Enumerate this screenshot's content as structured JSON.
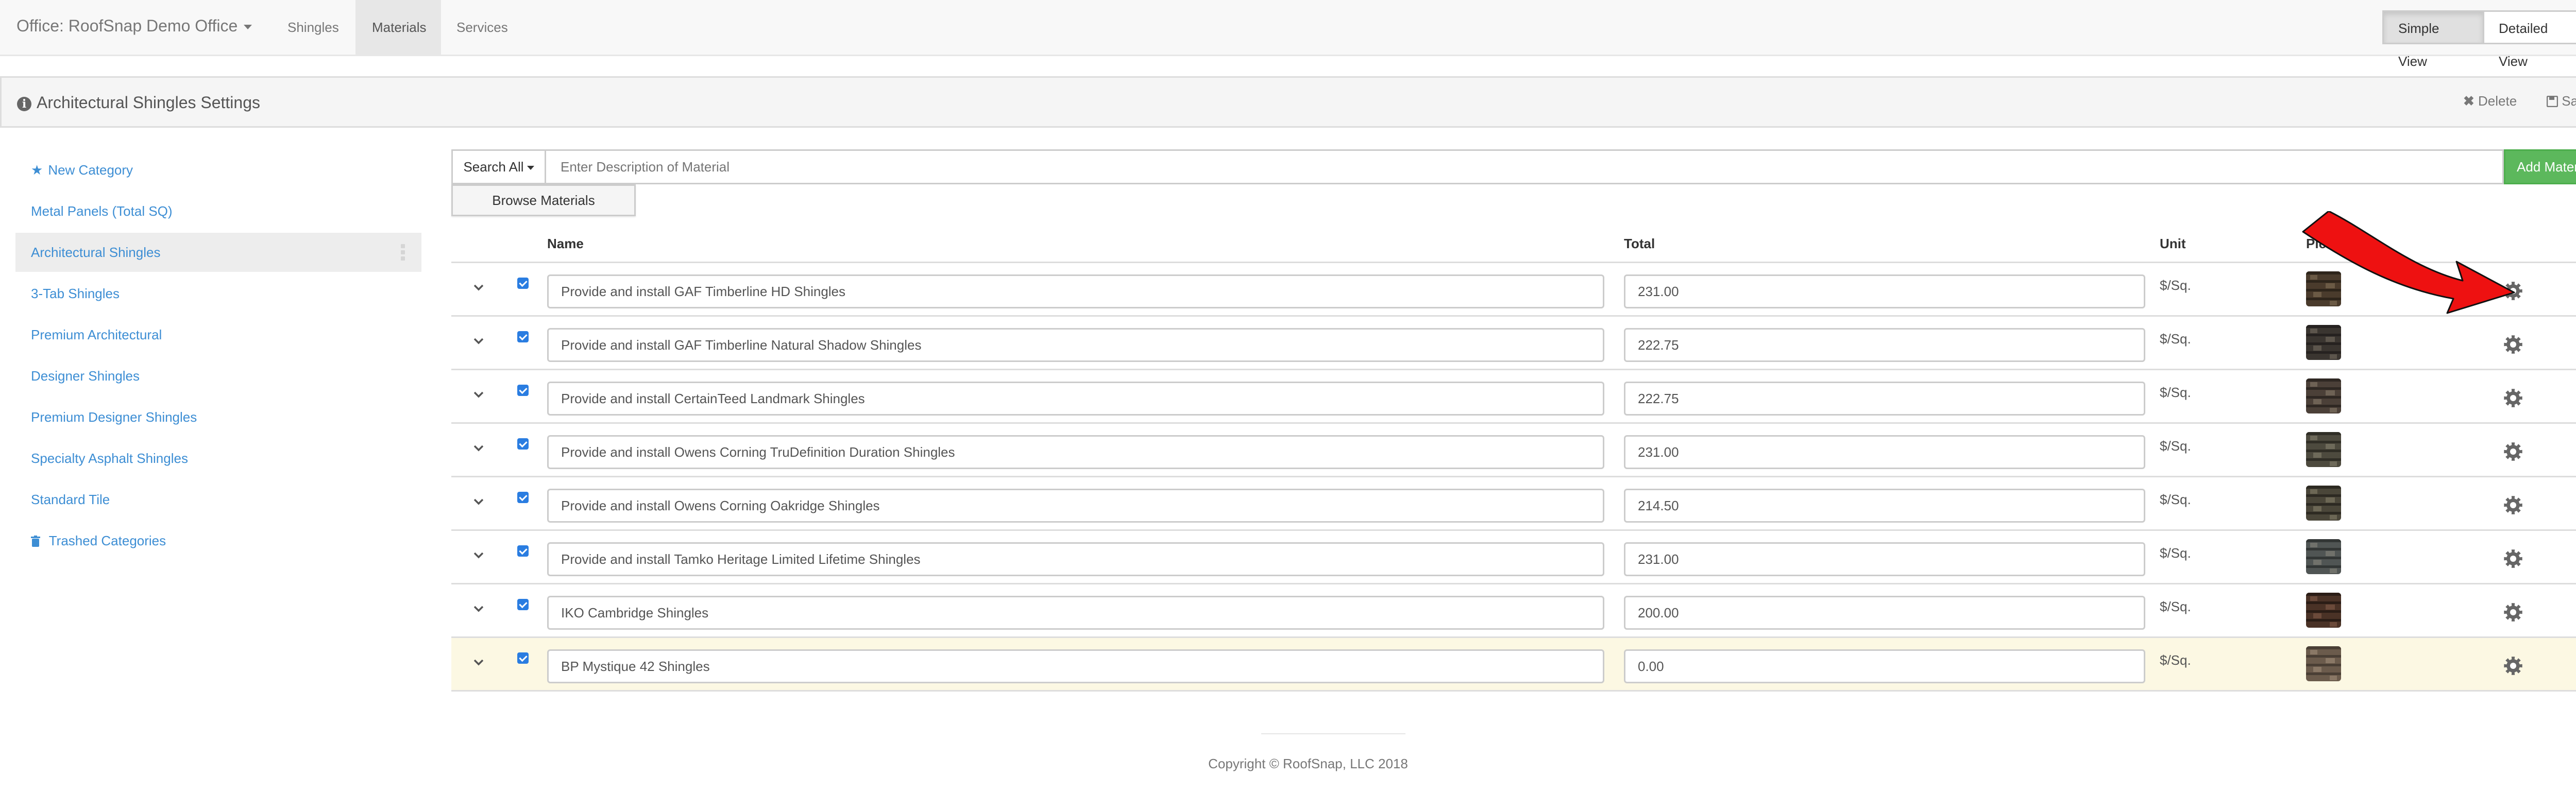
{
  "navbar": {
    "office_label": "Office: RoofSnap Demo Office",
    "tabs": [
      {
        "label": "Shingles"
      },
      {
        "label": "Materials"
      },
      {
        "label": "Services"
      }
    ],
    "simple_view_label": "Simple View",
    "detailed_view_label": "Detailed View"
  },
  "panel": {
    "title": "Architectural Shingles Settings",
    "delete_label": "Delete",
    "save_label": "Save"
  },
  "sidebar": {
    "items": [
      {
        "label": "New Category",
        "icon": "star-icon"
      },
      {
        "label": "Metal Panels (Total SQ)"
      },
      {
        "label": "Architectural Shingles"
      },
      {
        "label": "3-Tab Shingles"
      },
      {
        "label": "Premium Architectural"
      },
      {
        "label": "Designer Shingles"
      },
      {
        "label": "Premium Designer Shingles"
      },
      {
        "label": "Specialty Asphalt Shingles"
      },
      {
        "label": "Standard Tile"
      },
      {
        "label": "Trashed Categories",
        "icon": "trash-icon"
      }
    ]
  },
  "search": {
    "scope_label": "Search All",
    "placeholder": "Enter Description of Material",
    "add_label": "Add Material",
    "browse_label": "Browse Materials"
  },
  "table": {
    "headers": [
      "Name",
      "Total",
      "Unit",
      "Picture"
    ],
    "rows": [
      {
        "name": "Provide and install GAF Timberline HD Shingles",
        "total": "231.00",
        "unit": "$/Sq.",
        "checked": true
      },
      {
        "name": "Provide and install GAF Timberline Natural Shadow Shingles",
        "total": "222.75",
        "unit": "$/Sq.",
        "checked": true
      },
      {
        "name": "Provide and install CertainTeed Landmark Shingles",
        "total": "222.75",
        "unit": "$/Sq.",
        "checked": true
      },
      {
        "name": "Provide and install Owens Corning TruDefinition Duration Shingles",
        "total": "231.00",
        "unit": "$/Sq.",
        "checked": true
      },
      {
        "name": "Provide and install Owens Corning Oakridge Shingles",
        "total": "214.50",
        "unit": "$/Sq.",
        "checked": true
      },
      {
        "name": "Provide and install Tamko Heritage Limited Lifetime Shingles",
        "total": "231.00",
        "unit": "$/Sq.",
        "checked": true
      },
      {
        "name": "IKO Cambridge Shingles",
        "total": "200.00",
        "unit": "$/Sq.",
        "checked": true
      },
      {
        "name": "BP Mystique 42 Shingles",
        "total": "0.00",
        "unit": "$/Sq.",
        "checked": true
      }
    ]
  },
  "footer": {
    "copyright": "Copyright © RoofSnap, LLC 2018"
  },
  "colors": {
    "link": "#3d8ed4",
    "success": "#5cb85c",
    "highlight_row": "#fcf8e3",
    "annotation_arrow": "#ee1111"
  }
}
